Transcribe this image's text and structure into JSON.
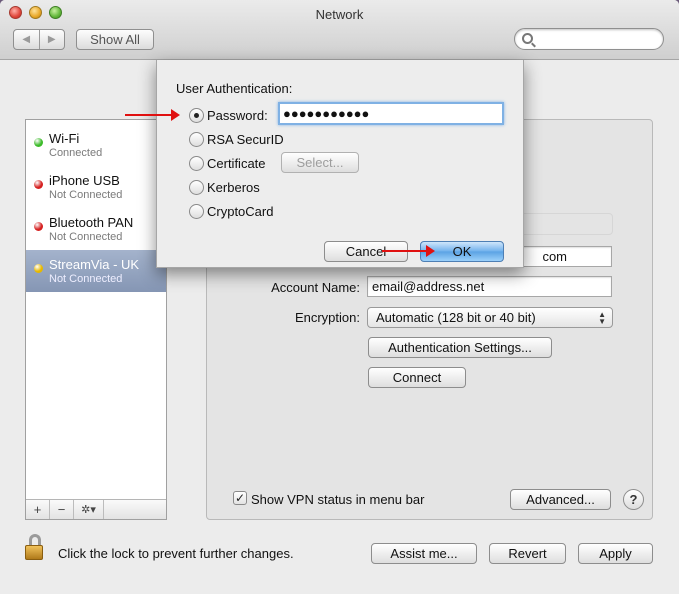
{
  "window": {
    "title": "Network",
    "show_all_label": "Show All",
    "nav_back_glyph": "◀",
    "nav_forward_glyph": "▶"
  },
  "sidebar": {
    "items": [
      {
        "name": "Wi-Fi",
        "status": "Connected",
        "dot_color": "#3dbb2a"
      },
      {
        "name": "iPhone USB",
        "status": "Not Connected",
        "dot_color": "#d52020"
      },
      {
        "name": "Bluetooth PAN",
        "status": "Not Connected",
        "dot_color": "#d52020"
      },
      {
        "name": "StreamVia - UK",
        "status": "Not Connected",
        "dot_color": "#e6b800",
        "selected": true
      }
    ],
    "add_label": "+",
    "remove_label": "−",
    "gear_label": "✲▾"
  },
  "panel": {
    "server_address_value": "com",
    "account_name_label": "Account Name:",
    "account_name_value": "email@address.net",
    "encryption_label": "Encryption:",
    "encryption_value": "Automatic (128 bit or 40 bit)",
    "auth_settings_label": "Authentication Settings...",
    "connect_label": "Connect",
    "show_vpn_label": "Show VPN status in menu bar",
    "show_vpn_checked": true,
    "advanced_label": "Advanced...",
    "help_label": "?"
  },
  "footer": {
    "lock_text": "Click the lock to prevent further changes.",
    "assist_label": "Assist me...",
    "revert_label": "Revert",
    "apply_label": "Apply"
  },
  "sheet": {
    "title": "User Authentication:",
    "options": [
      {
        "label": "Password:",
        "selected": true
      },
      {
        "label": "RSA SecurID",
        "selected": false
      },
      {
        "label": "Certificate",
        "selected": false
      },
      {
        "label": "Kerberos",
        "selected": false
      },
      {
        "label": "CryptoCard",
        "selected": false
      }
    ],
    "password_value": "●●●●●●●●●●●",
    "select_label": "Select...",
    "cancel_label": "Cancel",
    "ok_label": "OK"
  },
  "colors": {
    "annotation_arrow": "#e01010",
    "selection": "#8596b4"
  }
}
